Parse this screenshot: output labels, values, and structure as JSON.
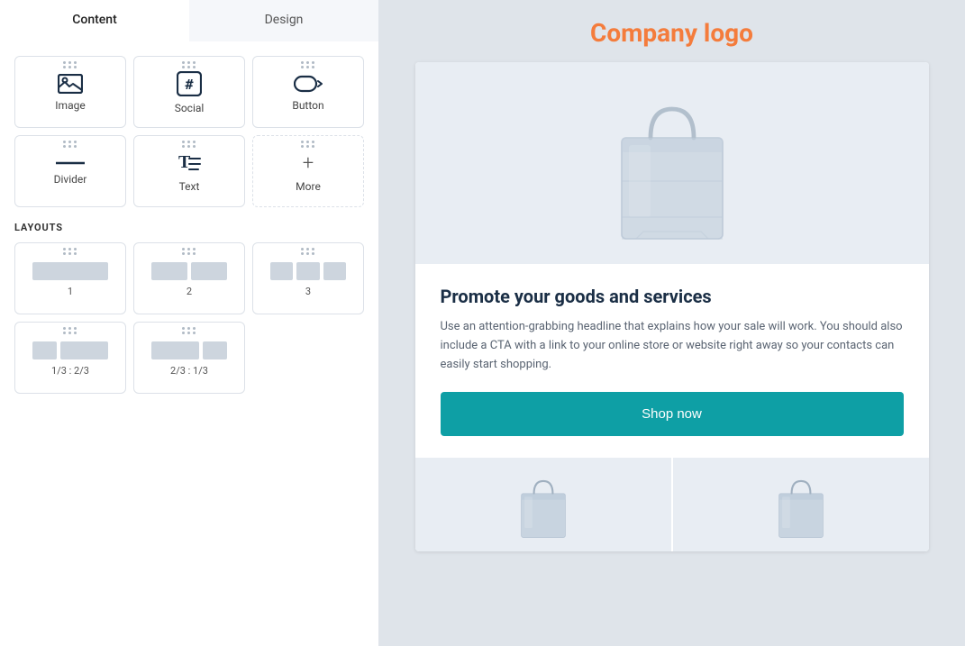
{
  "tabs": {
    "content": "Content",
    "design": "Design"
  },
  "components": [
    {
      "id": "image",
      "label": "Image",
      "icon": "image-icon"
    },
    {
      "id": "social",
      "label": "Social",
      "icon": "social-icon"
    },
    {
      "id": "button",
      "label": "Button",
      "icon": "button-icon"
    },
    {
      "id": "divider",
      "label": "Divider",
      "icon": "divider-icon"
    },
    {
      "id": "text",
      "label": "Text",
      "icon": "text-icon"
    },
    {
      "id": "more",
      "label": "More",
      "icon": "more-icon"
    }
  ],
  "layouts_title": "LAYOUTS",
  "layouts": [
    {
      "id": "layout-1",
      "label": "1",
      "type": "single"
    },
    {
      "id": "layout-2",
      "label": "2",
      "type": "double"
    },
    {
      "id": "layout-3",
      "label": "3",
      "type": "triple"
    },
    {
      "id": "layout-1/3-2/3",
      "label": "1/3 : 2/3",
      "type": "one-third-two-thirds"
    },
    {
      "id": "layout-2/3-1/3",
      "label": "2/3 : 1/3",
      "type": "two-thirds-one-third"
    }
  ],
  "preview": {
    "company_logo": "Company logo",
    "headline": "Promote your goods and services",
    "body_text": "Use an attention-grabbing headline that explains how your sale will work. You should also include a CTA with a link to your online store or website right away so your contacts can easily start shopping.",
    "cta_label": "Shop now"
  },
  "colors": {
    "company_logo": "#f47c3c",
    "cta_bg": "#0e9fa5",
    "cta_text": "#ffffff",
    "headline": "#1a2e45",
    "body": "#5a6472"
  }
}
